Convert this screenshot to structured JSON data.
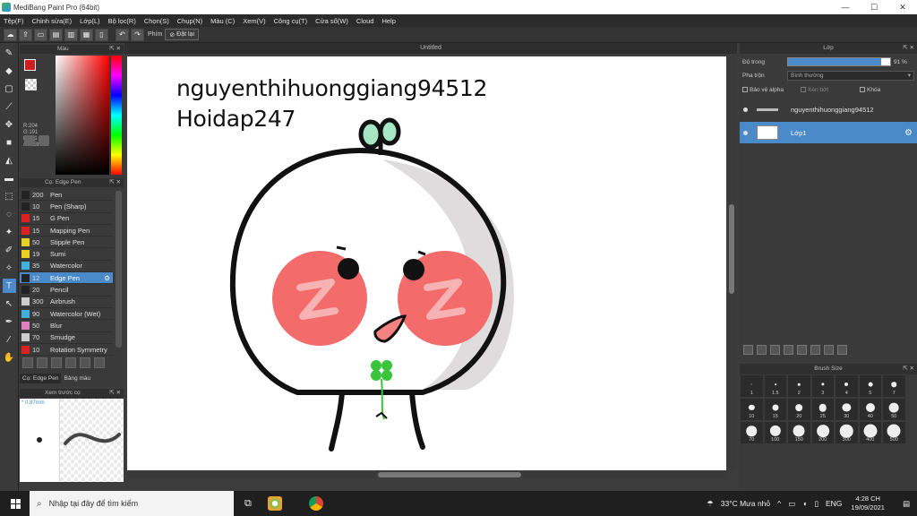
{
  "window": {
    "title": "MediBang Paint Pro (64bit)",
    "min": "—",
    "max": "☐",
    "close": "✕"
  },
  "menu": [
    "Tệp(F)",
    "Chỉnh sửa(E)",
    "Lớp(L)",
    "Bộ lọc(R)",
    "Chọn(S)",
    "Chụp(N)",
    "Màu (C)",
    "Xem(V)",
    "Công cụ(T)",
    "Cửa sổ(W)",
    "Cloud",
    "Help"
  ],
  "toolbar": {
    "hotkey_label": "Phím",
    "reset_label": "Đặt lại",
    "undo": "↶",
    "redo": "↷"
  },
  "color_panel": {
    "title": "Màu",
    "rgb": [
      "R:204",
      "G:191",
      "B:191"
    ],
    "hex": "#CCBFBF",
    "fg_color": "#cc2020"
  },
  "brush_panel": {
    "title": "Cọ: Edge Pen",
    "brushes": [
      {
        "size": "200",
        "name": "Pen",
        "color": "#222222"
      },
      {
        "size": "10",
        "name": "Pen (Sharp)",
        "color": "#222222"
      },
      {
        "size": "15",
        "name": "G Pen",
        "color": "#e02020"
      },
      {
        "size": "15",
        "name": "Mapping Pen",
        "color": "#e02020"
      },
      {
        "size": "50",
        "name": "Stipple Pen",
        "color": "#e8d020"
      },
      {
        "size": "19",
        "name": "Sumi",
        "color": "#e8d020"
      },
      {
        "size": "35",
        "name": "Watercolor",
        "color": "#40b0e0"
      },
      {
        "size": "12",
        "name": "Edge Pen",
        "color": "#222222"
      },
      {
        "size": "20",
        "name": "Pencil",
        "color": "#222222"
      },
      {
        "size": "300",
        "name": "Airbrush",
        "color": "#cccccc"
      },
      {
        "size": "90",
        "name": "Watercolor (Wet)",
        "color": "#40b0e0"
      },
      {
        "size": "50",
        "name": "Blur",
        "color": "#e080c0"
      },
      {
        "size": "70",
        "name": "Smudge",
        "color": "#cccccc"
      },
      {
        "size": "10",
        "name": "Rotation Symmetry",
        "color": "#e02020"
      }
    ],
    "tabs": [
      "Cọ: Edge Pen",
      "Bảng màu"
    ]
  },
  "preview_panel": {
    "title": "Xem trước cọ",
    "size": "* 0.87mm"
  },
  "canvas": {
    "tab_title": "Untitled",
    "text_line1": "nguyenthihuonggiang94512",
    "text_line2": "Hoidap247"
  },
  "layer_panel": {
    "title": "Lớp",
    "opacity_label": "Độ trong",
    "opacity_value": "91 %",
    "opacity_fraction": 0.91,
    "blend_label": "Pha trộn",
    "blend_value": "Bình thường",
    "protect_alpha": "Bảo vệ alpha",
    "clipping": "Xén bớt",
    "lock": "Khóa",
    "layers": [
      {
        "name": "nguyenthihuonggiang94512",
        "active": false
      },
      {
        "name": "Lớp1",
        "active": true
      }
    ]
  },
  "brush_size_panel": {
    "title": "Brush Size",
    "sizes": [
      "1",
      "1.5",
      "2",
      "3",
      "4",
      "5",
      "7",
      "10",
      "15",
      "20",
      "25",
      "30",
      "40",
      "50",
      "70",
      "100",
      "150",
      "200",
      "300",
      "400",
      "500"
    ]
  },
  "taskbar": {
    "search_placeholder": "Nhập tại đây để tìm kiếm",
    "weather": "33°C  Mưa nhỏ",
    "lang": "ENG",
    "time": "4:28 CH",
    "date": "19/09/2021"
  }
}
